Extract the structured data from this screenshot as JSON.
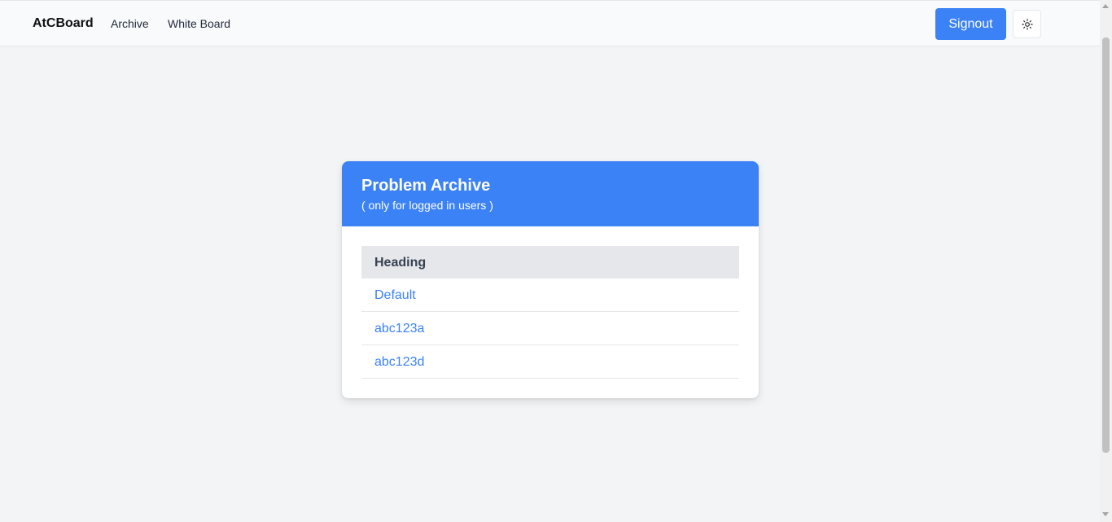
{
  "navbar": {
    "brand": "AtCBoard",
    "links": [
      {
        "label": "Archive"
      },
      {
        "label": "White Board"
      }
    ],
    "signout_label": "Signout",
    "theme_icon": "sun-icon"
  },
  "card": {
    "title": "Problem Archive",
    "subtitle": "( only for logged in users )",
    "table": {
      "header": "Heading",
      "rows": [
        "Default",
        "abc123a",
        "abc123d"
      ]
    }
  },
  "colors": {
    "accent": "#3b82f6",
    "background": "#f3f4f6",
    "header_row": "#e5e7eb"
  }
}
